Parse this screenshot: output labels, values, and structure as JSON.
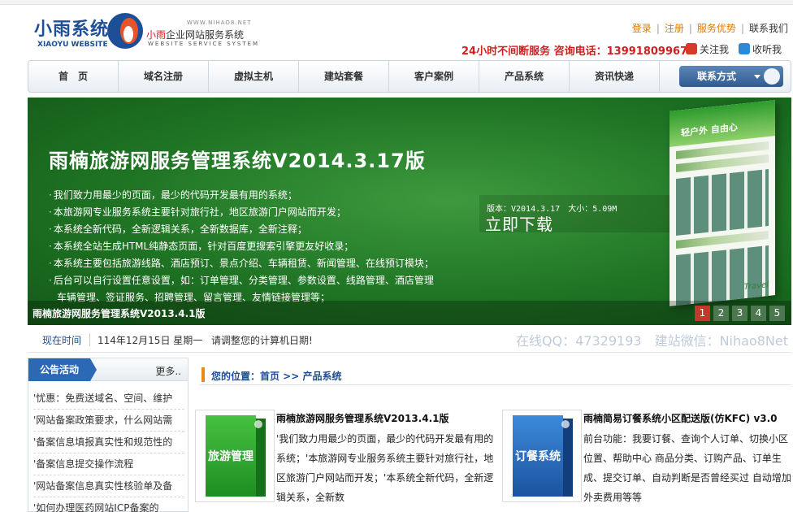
{
  "header": {
    "logo_cn": "小雨系统",
    "logo_en": "XIAOYU WEBSITE",
    "logo_url": "WWW.NIHAO8.NET",
    "logo_sub_red": "小雨",
    "logo_sub": "企业网站服务系统",
    "logo_sub2": "WEBSITE SERVICE SYSTEM",
    "links": {
      "login": "登录",
      "register": "注册",
      "advantage": "服务优势",
      "contact": "联系我们",
      "sep": "|"
    },
    "hotline": "24小时不间断服务 咨询电话：13991809967",
    "follow": "关注我",
    "favorite": "收听我"
  },
  "nav": {
    "items": [
      "首　页",
      "域名注册",
      "虚拟主机",
      "建站套餐",
      "客户案例",
      "产品系统",
      "资讯快递"
    ],
    "contact_button": "联系方式"
  },
  "banner": {
    "title": "雨楠旅游网服务管理系统V2014.3.17版",
    "features": [
      "我们致力用最少的页面，最少的代码开发最有用的系统；",
      "本旅游网专业服务系统主要针对旅行社，地区旅游门户网站而开发；",
      "本系统全新代码，全新逻辑关系，全新数据库，全新注释；",
      "本系统全站生成HTML纯静态页面，针对百度更搜索引擎更友好收录；",
      "本系统主要包括旅游线路、酒店预订、景点介绍、车辆租赁、新闻管理、在线预订模块；",
      "后台可以自行设置任意设置，如：订单管理、分类管理、参数设置、线路管理、酒店管理",
      "车辆管理、签证服务、招聘管理、留言管理、友情链接管理等；"
    ],
    "version": "版本：V2014.3.17　大小：5.09M",
    "download": "立即下载",
    "mock_text": "轻户外 自由心",
    "mock_foot": "Travel",
    "caption": "雨楠旅游网服务管理系统V2013.4.1版",
    "pages": [
      "1",
      "2",
      "3",
      "4",
      "5"
    ],
    "active_page": 1
  },
  "timebar": {
    "label": "现在时间",
    "date": "114年12月15日 星期一",
    "tip": "请调整您的计算机日期!",
    "qq": "在线QQ：47329193　建站微信：Nihao8Net"
  },
  "sidebar": {
    "title": "公告活动",
    "more": "更多..",
    "items": [
      "'忧惠：免费送域名、空间、维护",
      "'网站备案政策要求，什么网站需",
      "'备案信息填报真实性和规范性的",
      "'备案信息提交操作流程",
      "'网站备案信息真实性核验单及备",
      "'如何办理医药网站ICP备案的"
    ]
  },
  "main": {
    "breadcrumb": "您的位置：首页 >> 产品系统",
    "products": [
      {
        "box_label": "旅游管理",
        "title": "雨楠旅游网服务管理系统V2013.4.1版",
        "desc": "'我们致力用最少的页面，最少的代码开发最有用的系统；'本旅游网专业服务系统主要针对旅行社，地区旅游门户网站而开发；'本系统全新代码，全新逻辑关系，全新数"
      },
      {
        "box_label": "订餐系统",
        "title": "雨楠简易订餐系统小区配送版(仿KFC) v3.0",
        "desc": "前台功能：我要订餐、查询个人订单、切换小区位置、帮助中心 商品分类、订购产品、订单生成、提交订单、自动判断是否曾经买过 自动增加外卖费用等等"
      }
    ]
  }
}
